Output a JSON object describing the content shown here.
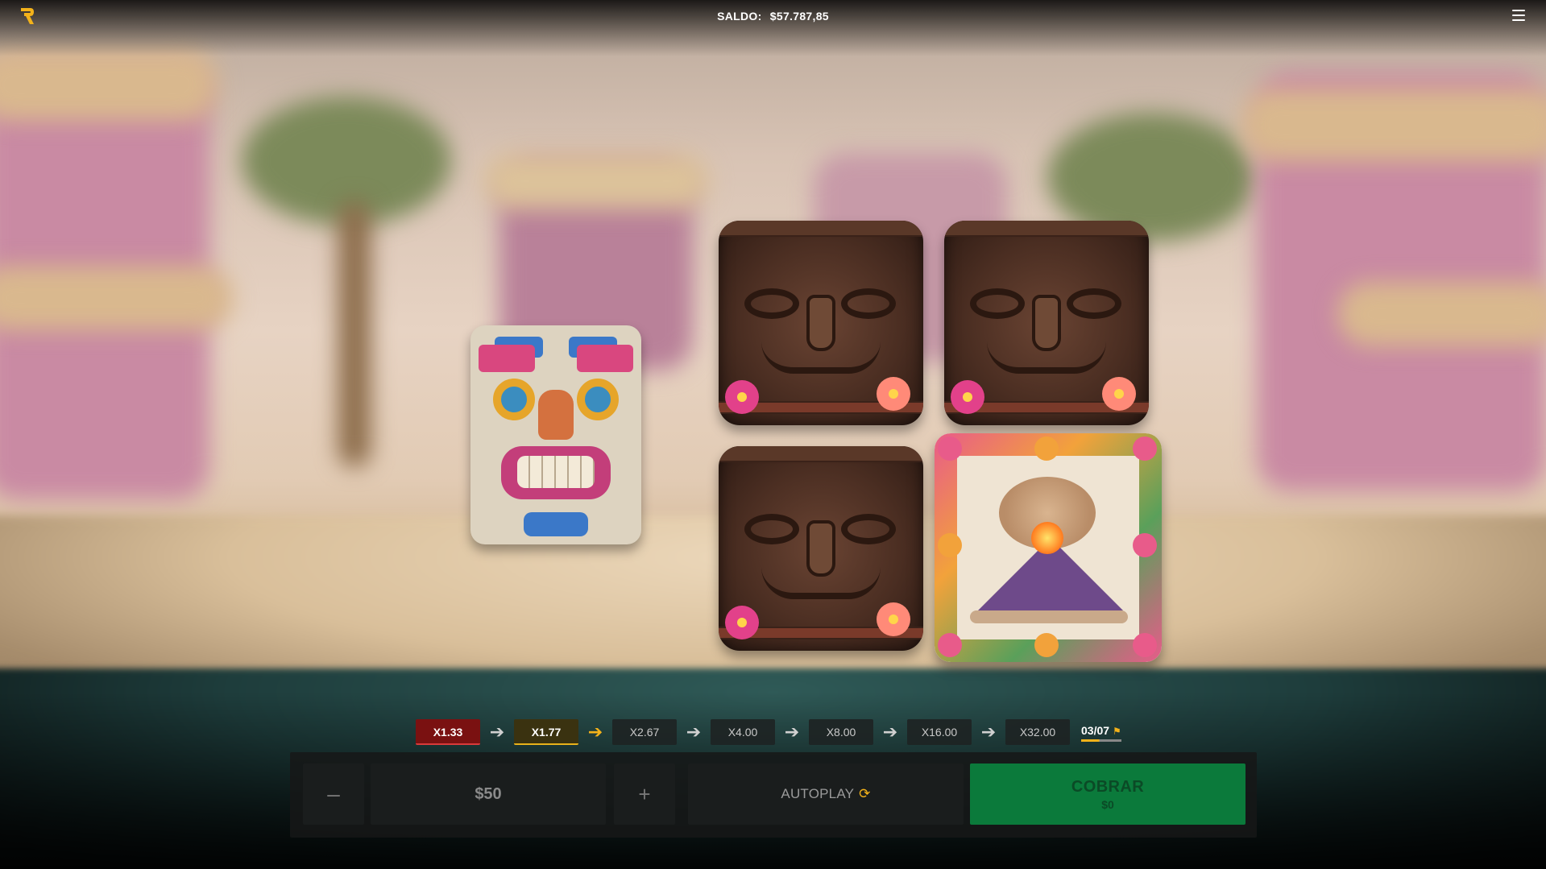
{
  "header": {
    "balance_label": "SALDO:",
    "balance_value": "$57.787,85"
  },
  "colors": {
    "accent": "#f3b21a",
    "cashout_green": "#0b7a3b",
    "done_red": "#7a1111"
  },
  "board": {
    "tiles": [
      {
        "name": "tiki-mask-colorful",
        "icon": "tiki-mask-icon"
      },
      {
        "name": "wooden-barrel",
        "icon": "barrel-icon"
      },
      {
        "name": "wooden-barrel",
        "icon": "barrel-icon"
      },
      {
        "name": "wooden-barrel",
        "icon": "barrel-icon"
      },
      {
        "name": "volcano-card",
        "icon": "volcano-icon"
      }
    ]
  },
  "ladder": {
    "steps": [
      "X1.33",
      "X1.77",
      "X2.67",
      "X4.00",
      "X8.00",
      "X16.00",
      "X32.00"
    ],
    "completed": 1,
    "current_index": 1,
    "progress": "03/07"
  },
  "controls": {
    "minus_label": "–",
    "bet_value": "$50",
    "plus_label": "+",
    "autoplay_label": "AUTOPLAY",
    "cashout_label": "COBRAR",
    "cashout_value": "$0"
  }
}
